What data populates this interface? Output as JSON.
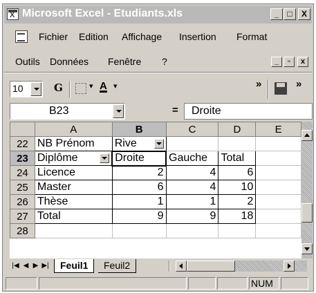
{
  "window": {
    "title": "Microsoft Excel - Etudiants.xls"
  },
  "title_buttons": {
    "minimize": "_",
    "maximize": "□",
    "close": "X"
  },
  "menu": {
    "row1": [
      {
        "label": "Fichier"
      },
      {
        "label": "Edition"
      },
      {
        "label": "Affichage"
      },
      {
        "label": "Insertion"
      },
      {
        "label": "Format"
      }
    ],
    "row2": [
      {
        "label": "Outils"
      },
      {
        "label": "Données"
      },
      {
        "label": "Fenêtre"
      },
      {
        "label": "?"
      }
    ]
  },
  "toolbar": {
    "font_size": "10",
    "bold": "G",
    "font_color": "A",
    "more": "»",
    "save_icon": "save-icon"
  },
  "formula_bar": {
    "name_box": "B23",
    "equals": "=",
    "content": "Droite"
  },
  "grid": {
    "columns": [
      "A",
      "B",
      "C",
      "D",
      "E"
    ],
    "selected_column": "B",
    "selected_row": "23",
    "rows": [
      {
        "num": "22",
        "cells": [
          "NB Prénom",
          "Rive",
          "",
          "",
          ""
        ]
      },
      {
        "num": "23",
        "cells": [
          "Diplôme",
          "Droite",
          "Gauche",
          "Total",
          ""
        ]
      },
      {
        "num": "24",
        "cells": [
          "Licence",
          "2",
          "4",
          "6",
          ""
        ]
      },
      {
        "num": "25",
        "cells": [
          "Master",
          "6",
          "4",
          "10",
          ""
        ]
      },
      {
        "num": "26",
        "cells": [
          "Thèse",
          "1",
          "1",
          "2",
          ""
        ]
      },
      {
        "num": "27",
        "cells": [
          "Total",
          "9",
          "9",
          "18",
          ""
        ]
      },
      {
        "num": "28",
        "cells": [
          "",
          "",
          "",
          "",
          ""
        ]
      }
    ]
  },
  "sheet_tabs": [
    {
      "label": "Feuil1",
      "active": true
    },
    {
      "label": "Feuil2",
      "active": false
    }
  ],
  "status_bar": {
    "num": "NUM"
  },
  "colors": {
    "titlebar": "#b9b9b9",
    "chrome": "#d4d0c8",
    "selected_header": "#bdbdbd"
  }
}
